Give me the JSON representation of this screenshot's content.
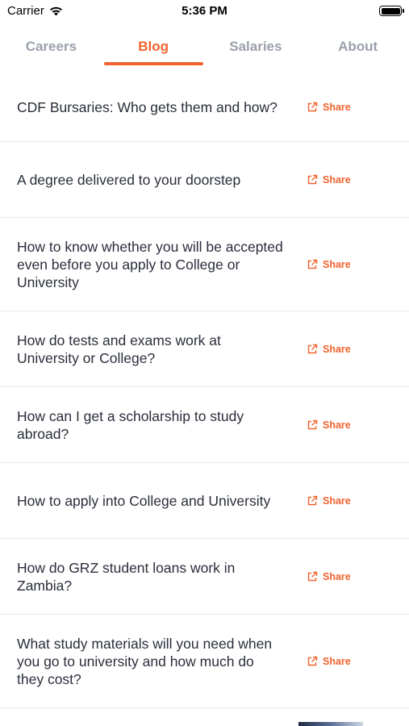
{
  "status": {
    "carrier": "Carrier",
    "time": "5:36 PM"
  },
  "tabs": [
    {
      "label": "Careers",
      "active": false
    },
    {
      "label": "Blog",
      "active": true
    },
    {
      "label": "Salaries",
      "active": false
    },
    {
      "label": "About",
      "active": false
    }
  ],
  "share_label": "Share",
  "posts": [
    {
      "title": "CDF Bursaries: Who gets them and how?"
    },
    {
      "title": "A degree delivered to your doorstep"
    },
    {
      "title": "How to know whether you will be accepted even before you apply to College or University"
    },
    {
      "title": "How do tests and exams work at University or College?"
    },
    {
      "title": "How can I get a scholarship to study abroad?"
    },
    {
      "title": "How to apply into College and University"
    },
    {
      "title": "How do GRZ student loans work in Zambia?"
    },
    {
      "title": "What study materials will you need when you go to university and how much do they cost?"
    }
  ],
  "colors": {
    "accent": "#f0622d",
    "inactive_tab": "#9aa0ab",
    "text": "#2a2e3b",
    "divider": "#e8e9ec"
  }
}
